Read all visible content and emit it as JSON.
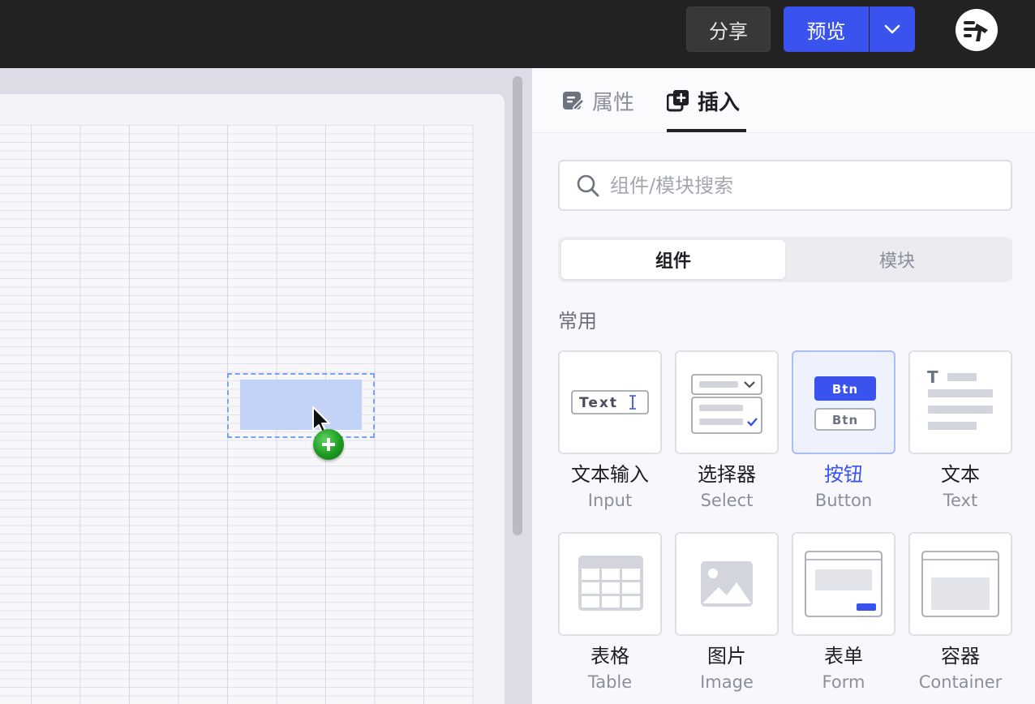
{
  "topbar": {
    "share_label": "分享",
    "preview_label": "预览"
  },
  "panel": {
    "tabs": [
      {
        "label": "属性",
        "active": false
      },
      {
        "label": "插入",
        "active": true
      }
    ],
    "search": {
      "placeholder": "组件/模块搜索",
      "value": ""
    },
    "segments": [
      {
        "label": "组件",
        "active": true
      },
      {
        "label": "模块",
        "active": false
      }
    ],
    "section_title": "常用",
    "components": [
      {
        "name": "文本输入",
        "sub": "Input",
        "icon": "text-input-icon",
        "preview_text": "Text"
      },
      {
        "name": "选择器",
        "sub": "Select",
        "icon": "select-icon"
      },
      {
        "name": "按钮",
        "sub": "Button",
        "icon": "button-icon",
        "preview_text": "Btn",
        "active": true
      },
      {
        "name": "文本",
        "sub": "Text",
        "icon": "text-icon",
        "preview_text": "T"
      },
      {
        "name": "表格",
        "sub": "Table",
        "icon": "table-icon"
      },
      {
        "name": "图片",
        "sub": "Image",
        "icon": "image-icon"
      },
      {
        "name": "表单",
        "sub": "Form",
        "icon": "form-icon"
      },
      {
        "name": "容器",
        "sub": "Container",
        "icon": "container-icon"
      }
    ]
  },
  "colors": {
    "topbar_bg": "#222222",
    "primary": "#3a52ee",
    "canvas_bg": "#dcdce7",
    "drop_fill": "#c3d3f7",
    "plus_green": "#1d9a22"
  }
}
